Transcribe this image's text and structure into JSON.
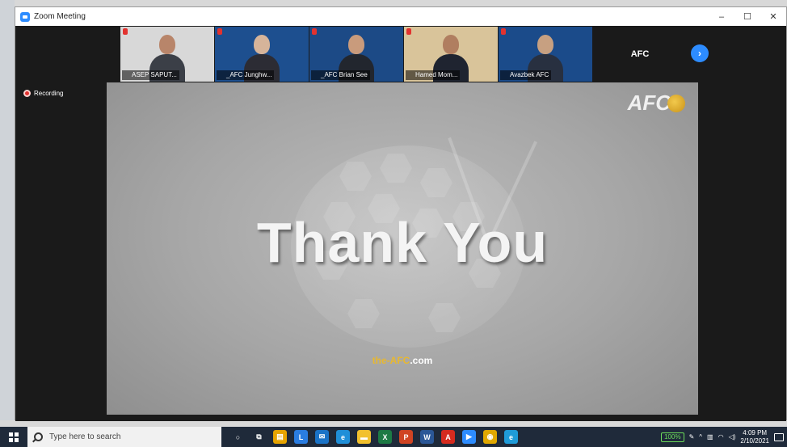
{
  "window": {
    "title": "Zoom Meeting",
    "controls": {
      "minimize": "–",
      "maximize": "☐",
      "close": "✕"
    }
  },
  "participants": [
    {
      "name": "ASEP SAPUT...",
      "bg": "#d8d8d8",
      "suit": "#3b3f47",
      "skin": "#b8856a"
    },
    {
      "name": "_AFC Junghw...",
      "bg": "#1d4f8f",
      "suit": "#2c2c34",
      "skin": "#d6b49a"
    },
    {
      "name": "_AFC Brian See",
      "bg": "#1c4a86",
      "suit": "#22262e",
      "skin": "#c99b7c"
    },
    {
      "name": "Hamed Mom...",
      "bg": "#d9c49a",
      "suit": "#1f2430",
      "skin": "#b07e60"
    },
    {
      "name": "Avazbek AFC",
      "bg": "#1b4b8a",
      "suit": "#283040",
      "skin": "#c7a081"
    }
  ],
  "afc_tile_label": "AFC",
  "next_icon": "›",
  "recording_label": "Recording",
  "slide": {
    "title": "Thank You",
    "url_part1": "the-AFC",
    "url_part2": ".com",
    "logo_text": "AFC"
  },
  "taskbar": {
    "search_placeholder": "Type here to search",
    "apps": [
      {
        "icon": "cortana-icon",
        "glyph": "○",
        "color": "transparent"
      },
      {
        "icon": "task-view-icon",
        "glyph": "⧉",
        "color": "transparent"
      },
      {
        "icon": "store-icon",
        "glyph": "▤",
        "color": "#e6a400"
      },
      {
        "icon": "launcher-icon",
        "glyph": "L",
        "color": "#2a7de1"
      },
      {
        "icon": "mail-icon",
        "glyph": "✉",
        "color": "#1a73c7"
      },
      {
        "icon": "edge-icon",
        "glyph": "e",
        "color": "#1f8fd8"
      },
      {
        "icon": "explorer-icon",
        "glyph": "▬",
        "color": "#f2c12e"
      },
      {
        "icon": "excel-icon",
        "glyph": "X",
        "color": "#1d7a45"
      },
      {
        "icon": "powerpoint-icon",
        "glyph": "P",
        "color": "#d04423"
      },
      {
        "icon": "word-icon",
        "glyph": "W",
        "color": "#2b5797"
      },
      {
        "icon": "acrobat-icon",
        "glyph": "A",
        "color": "#d62b1f"
      },
      {
        "icon": "zoom-icon",
        "glyph": "▶",
        "color": "#2d8cff"
      },
      {
        "icon": "chrome-icon",
        "glyph": "◉",
        "color": "#e0a800"
      },
      {
        "icon": "app-icon",
        "glyph": "e",
        "color": "#1f9bd8"
      }
    ],
    "battery": "100%",
    "time": "4:09 PM",
    "date": "2/10/2021"
  }
}
